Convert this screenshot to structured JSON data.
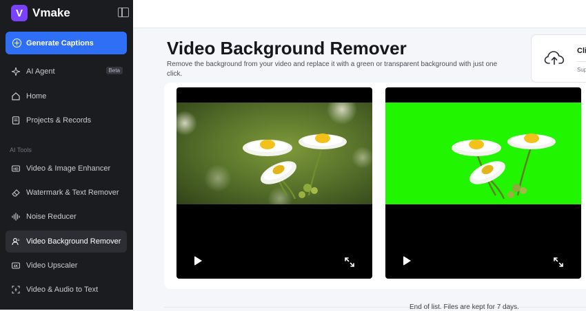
{
  "app": {
    "name": "Vmake",
    "logo_letter": "V"
  },
  "sidebar": {
    "generate_button": "Generate Captions",
    "items": [
      {
        "label": "AI Agent",
        "badge": "Beta"
      },
      {
        "label": "Home"
      },
      {
        "label": "Projects & Records"
      }
    ],
    "section_label": "AI Tools",
    "tools": [
      {
        "label": "Video & Image Enhancer",
        "icon": "hd-icon"
      },
      {
        "label": "Watermark & Text Remover",
        "icon": "eraser-icon"
      },
      {
        "label": "Noise Reducer",
        "icon": "waveform-icon"
      },
      {
        "label": "Video Background Remover",
        "icon": "person-cutout-icon",
        "active": true
      },
      {
        "label": "Video Upscaler",
        "icon": "4k-icon"
      },
      {
        "label": "Video & Audio to Text",
        "icon": "transcribe-icon"
      }
    ]
  },
  "main": {
    "title": "Video Background Remover",
    "description": "Remove the background from your video and replace it with a green or transparent background with just one click.",
    "upload": {
      "title": "Cli",
      "subtitle": "Sup"
    },
    "footer_note": "End of list. Files are kept for 7 days."
  },
  "colors": {
    "accent": "#2f6ff5",
    "green_screen": "#22f500",
    "sidebar_bg": "#1b1c20"
  }
}
